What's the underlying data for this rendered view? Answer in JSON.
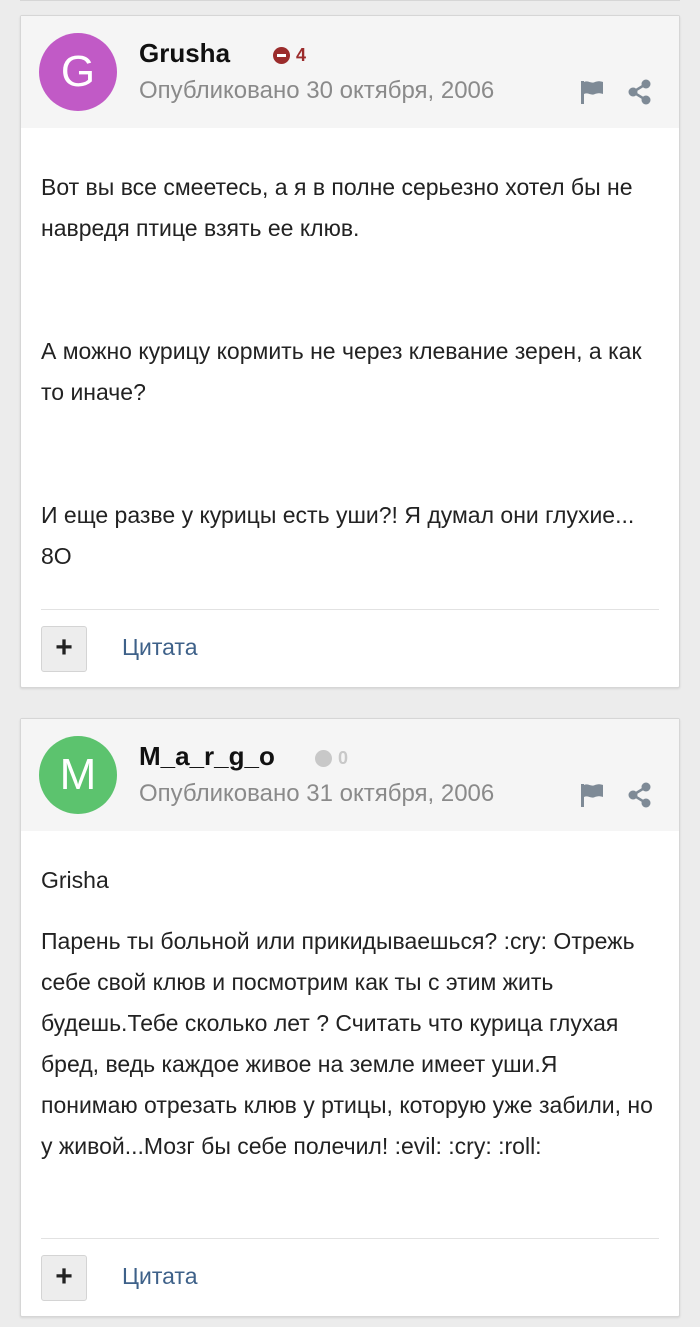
{
  "posts": [
    {
      "avatar_letter": "G",
      "avatar_color": "#c15ac6",
      "author": "Grusha",
      "reputation": "4",
      "reputation_color": "#9b2c2c",
      "date": "Опубликовано 30 октября, 2006",
      "paragraphs": [
        "Вот вы все смеетесь, а я в полне серьезно хотел бы не навредя птице взять ее клюв.",
        "А можно курицу кормить не через клевание зерен, а как то иначе?",
        "И еще разве у курицы есть уши?! Я думал они глухие... 8O"
      ],
      "plus_label": "+",
      "quote_label": "Цитата"
    },
    {
      "avatar_letter": "M",
      "avatar_color": "#5cc36e",
      "author": "M_a_r_g_o",
      "reputation": "0",
      "reputation_color": "#c8c8c8",
      "date": "Опубликовано 31 октября, 2006",
      "paragraphs": [
        "Grisha",
        "Парень ты больной или прикидываешься? :cry: Отрежь себе свой клюв и посмотрим как ты с этим жить будешь.Тебе сколько лет ? Считать что курица глухая бред, ведь каждое живое на земле имеет уши.Я понимаю отрезать клюв у ртицы, которую уже забили, но у живой...Мозг бы себе полечил! :evil: :cry: :roll:"
      ],
      "plus_label": "+",
      "quote_label": "Цитата"
    }
  ],
  "icons": {
    "flag": "flag-icon",
    "share": "share-icon",
    "reputation_negative": "minus-circle-icon",
    "reputation_neutral": "circle-icon"
  }
}
